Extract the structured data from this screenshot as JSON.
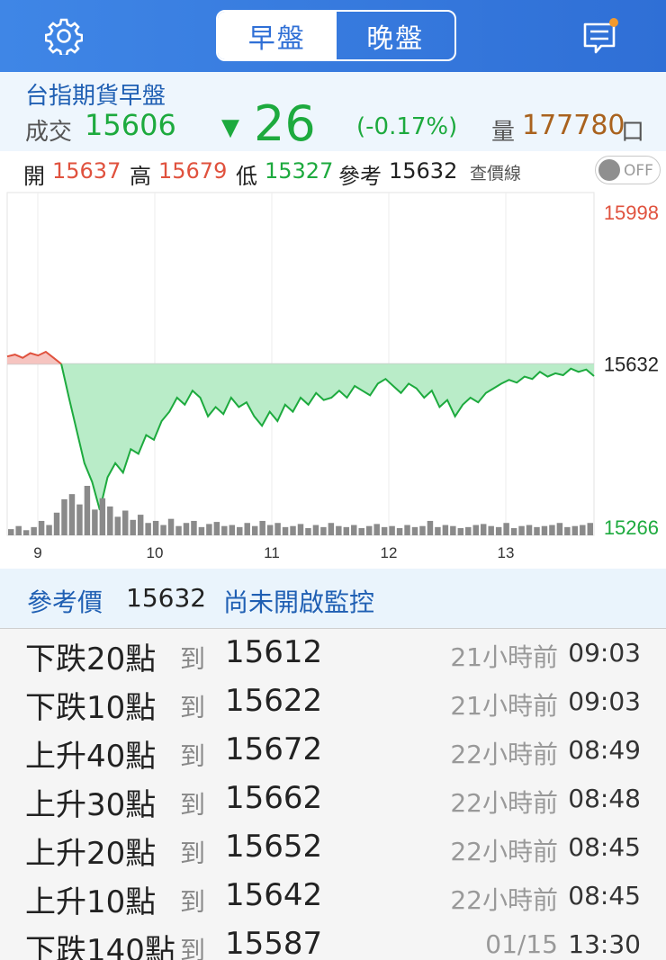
{
  "header": {
    "tabs": [
      {
        "label": "早盤",
        "active": true
      },
      {
        "label": "晚盤",
        "active": false
      }
    ],
    "settings_icon": "gear-icon",
    "messages_icon": "chat-icon",
    "accent": "#2f6fd6"
  },
  "quote": {
    "name": "台指期貨早盤",
    "deal_label": "成交",
    "deal_value": "15606",
    "change": "26",
    "change_pct": "(-0.17%)",
    "volume_label": "量",
    "volume_value": "177780",
    "volume_unit": "口",
    "down_color": "#1daa3e",
    "up_color": "#e0523e"
  },
  "ohlc": {
    "open_label": "開",
    "open": "15637",
    "high_label": "高",
    "high": "15679",
    "low_label": "低",
    "low": "15327",
    "ref_label": "參考",
    "ref": "15632",
    "price_line_label": "查價線",
    "toggle_label": "OFF"
  },
  "chart_data": {
    "type": "area",
    "x_ticks": [
      "9",
      "10",
      "11",
      "12",
      "13"
    ],
    "y_labels": {
      "top": "15998",
      "ref": "15632",
      "bottom": "15266"
    },
    "ylim": [
      15266,
      15998
    ],
    "reference": 15632,
    "series": [
      {
        "values": [
          15648,
          15652,
          15645,
          15655,
          15650,
          15658,
          15645,
          15632,
          15560,
          15490,
          15420,
          15380,
          15320,
          15390,
          15420,
          15400,
          15450,
          15440,
          15480,
          15470,
          15510,
          15530,
          15560,
          15545,
          15575,
          15560,
          15520,
          15540,
          15525,
          15560,
          15540,
          15550,
          15520,
          15500,
          15530,
          15510,
          15545,
          15530,
          15560,
          15545,
          15570,
          15555,
          15560,
          15575,
          15560,
          15585,
          15575,
          15565,
          15590,
          15600,
          15585,
          15570,
          15590,
          15580,
          15560,
          15575,
          15540,
          15555,
          15520,
          15545,
          15560,
          15550,
          15570,
          15580,
          15590,
          15598,
          15592,
          15605,
          15600,
          15615,
          15605,
          15612,
          15608,
          15622,
          15615,
          15620,
          15606
        ]
      }
    ],
    "volume": [
      6,
      9,
      5,
      8,
      14,
      10,
      22,
      35,
      40,
      30,
      48,
      25,
      36,
      28,
      18,
      24,
      15,
      20,
      12,
      14,
      10,
      16,
      9,
      12,
      14,
      8,
      11,
      13,
      9,
      10,
      8,
      12,
      9,
      14,
      10,
      12,
      8,
      9,
      11,
      7,
      10,
      8,
      12,
      9,
      8,
      10,
      7,
      9,
      11,
      8,
      9,
      7,
      10,
      8,
      9,
      14,
      8,
      10,
      9,
      7,
      8,
      10,
      11,
      9,
      8,
      12,
      7,
      9,
      10,
      8,
      9,
      10,
      12,
      8,
      9,
      10,
      12
    ]
  },
  "alerts": {
    "ref_label": "參考價",
    "ref_value": "15632",
    "status": "尚未開啟監控",
    "rows": [
      {
        "dir": "下跌20點",
        "to": "到",
        "price": "15612",
        "ago": "21小時前",
        "time": "09:03"
      },
      {
        "dir": "下跌10點",
        "to": "到",
        "price": "15622",
        "ago": "21小時前",
        "time": "09:03"
      },
      {
        "dir": "上升40點",
        "to": "到",
        "price": "15672",
        "ago": "22小時前",
        "time": "08:49"
      },
      {
        "dir": "上升30點",
        "to": "到",
        "price": "15662",
        "ago": "22小時前",
        "time": "08:48"
      },
      {
        "dir": "上升20點",
        "to": "到",
        "price": "15652",
        "ago": "22小時前",
        "time": "08:45"
      },
      {
        "dir": "上升10點",
        "to": "到",
        "price": "15642",
        "ago": "22小時前",
        "time": "08:45"
      },
      {
        "dir": "下跌140點",
        "to": "到",
        "price": "15587",
        "ago": "01/15",
        "time": "13:30"
      }
    ]
  }
}
